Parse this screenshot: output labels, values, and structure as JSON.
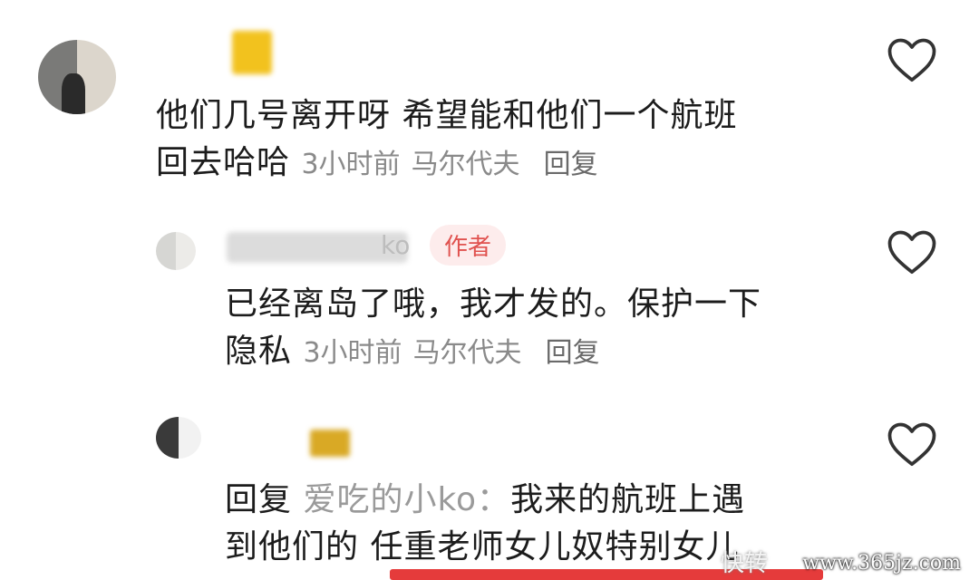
{
  "comments": [
    {
      "line1": "他们几号离开呀 希望能和他们一个航班",
      "line2": "回去哈哈",
      "time": "3小时前",
      "location": "马尔代夫",
      "reply": "回复"
    },
    {
      "name": "ko",
      "author_tag": "作者",
      "line1": "已经离岛了哦，我才发的。保护一下",
      "line2": "隐私",
      "time": "3小时前",
      "location": "马尔代夫",
      "reply": "回复"
    },
    {
      "reply_prefix": "回复",
      "mention": "爱吃的小ko：",
      "line1_rest": "我来的航班上遇",
      "line2": "到他们的 任重老师女儿奴特别女儿"
    }
  ],
  "watermark": "www.365jz.com",
  "watermark_left": "快转"
}
